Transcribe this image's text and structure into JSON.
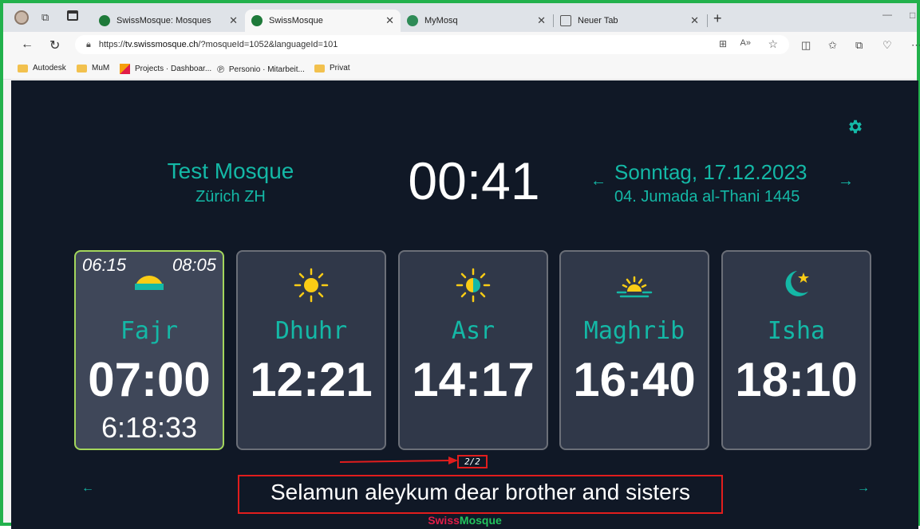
{
  "browser": {
    "tabs": [
      {
        "label": "SwissMosque: Mosques",
        "active": false
      },
      {
        "label": "SwissMosque",
        "active": true
      },
      {
        "label": "MyMosq",
        "active": false
      },
      {
        "label": "Neuer Tab",
        "active": false
      }
    ],
    "url_prefix": "https://",
    "url_host": "tv.swissmosque.ch",
    "url_rest": "/?mosqueId=1052&languageId=101",
    "bookmarks": [
      "Autodesk",
      "MuM",
      "Projects · Dashboar...",
      "Personio · Mitarbeit...",
      "Privat"
    ]
  },
  "header": {
    "mosque_name": "Test Mosque",
    "mosque_city": "Zürich ZH",
    "clock": "00:41",
    "date_gregorian": "Sonntag, 17.12.2023",
    "date_hijri": "04. Jumada al-Thani 1445"
  },
  "prayers": [
    {
      "name": "Fajr",
      "time": "07:00",
      "countdown": "6:18:33",
      "range_start": "06:15",
      "range_end": "08:05",
      "icon": "sunrise-icon",
      "active": true
    },
    {
      "name": "Dhuhr",
      "time": "12:21",
      "icon": "sun-icon",
      "active": false
    },
    {
      "name": "Asr",
      "time": "14:17",
      "icon": "half-sun-icon",
      "active": false
    },
    {
      "name": "Maghrib",
      "time": "16:40",
      "icon": "sunset-icon",
      "active": false
    },
    {
      "name": "Isha",
      "time": "18:10",
      "icon": "moon-star-icon",
      "active": false
    }
  ],
  "pager": "2/2",
  "message": "Selamun aleykum dear brother and sisters",
  "brand": {
    "part1": "Swiss",
    "part2": "Mosque"
  },
  "colors": {
    "accent": "#14b8a6",
    "background": "#101826",
    "card": "#303849",
    "active_border": "#a3d65c",
    "highlight": "#e11d1d"
  }
}
